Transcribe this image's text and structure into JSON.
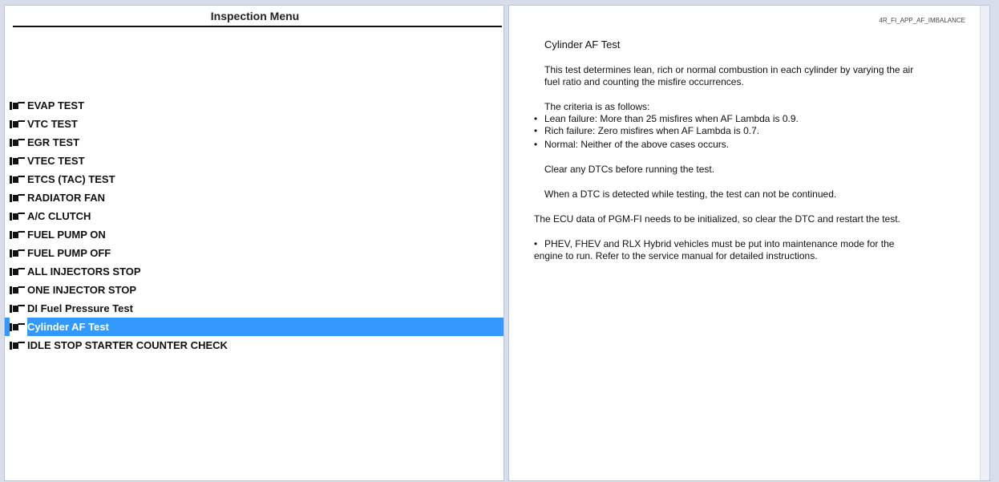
{
  "left": {
    "title": "Inspection Menu",
    "items": [
      {
        "label": "EVAP TEST",
        "selected": false
      },
      {
        "label": "VTC TEST",
        "selected": false
      },
      {
        "label": "EGR TEST",
        "selected": false
      },
      {
        "label": "VTEC TEST",
        "selected": false
      },
      {
        "label": "ETCS (TAC) TEST",
        "selected": false
      },
      {
        "label": "RADIATOR FAN",
        "selected": false
      },
      {
        "label": "A/C CLUTCH",
        "selected": false
      },
      {
        "label": "FUEL PUMP ON",
        "selected": false
      },
      {
        "label": "FUEL PUMP OFF",
        "selected": false
      },
      {
        "label": "ALL INJECTORS STOP",
        "selected": false
      },
      {
        "label": "ONE INJECTOR STOP",
        "selected": false
      },
      {
        "label": "DI Fuel Pressure Test",
        "selected": false
      },
      {
        "label": "Cylinder AF Test",
        "selected": true
      },
      {
        "label": "IDLE STOP STARTER COUNTER CHECK",
        "selected": false
      }
    ],
    "selection_color": "#3399ff",
    "item_icon": "pointing-hand-icon"
  },
  "right": {
    "doc_id": "4R_FI_APP_AF_IMBALANCE",
    "heading": "Cylinder AF Test",
    "description_line1": "This test determines lean, rich or normal combustion in each cylinder by varying the air",
    "description_line2": "fuel ratio and counting the misfire occurrences.",
    "criteria_intro": "The criteria is as follows:",
    "criteria": [
      "Lean failure: More than 25 misfires when AF Lambda is 0.9.",
      "Rich failure: Zero misfires when AF Lambda is 0.7.",
      "Normal: Neither of the above cases occurs."
    ],
    "clear_note": "Clear any DTCs before running the test.",
    "dtc_note": "When a DTC is detected while testing, the test can not be continued.",
    "ecu_note": "The ECU data of PGM-FI needs to be initialized, so clear the DTC and restart the test.",
    "hybrid_note_line1": "PHEV, FHEV and RLX Hybrid vehicles must be put into maintenance mode for the",
    "hybrid_note_line2": "engine to run. Refer to the service manual for detailed instructions.",
    "bullet_glyph": "•"
  }
}
